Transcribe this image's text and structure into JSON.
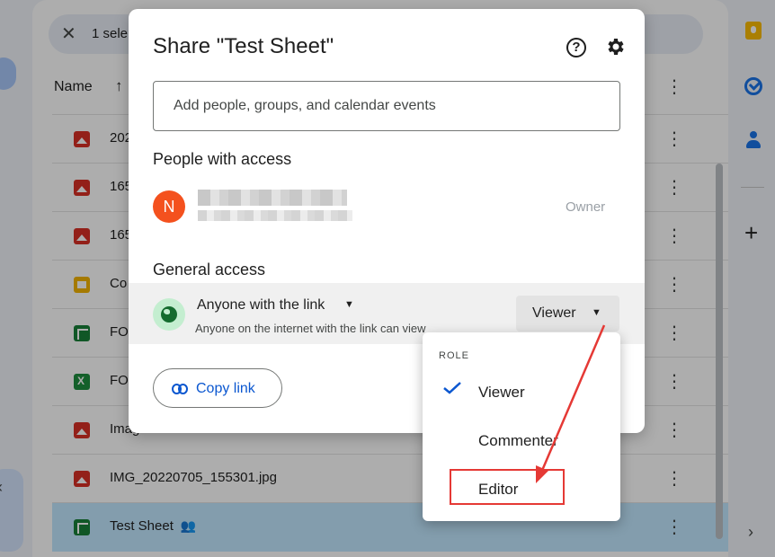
{
  "background": {
    "selection_count": "1 sele",
    "header": {
      "name": "Name"
    },
    "files": [
      {
        "name": "202",
        "type": "image",
        "selected": false
      },
      {
        "name": "165",
        "type": "image",
        "selected": false
      },
      {
        "name": "165",
        "type": "image",
        "selected": false
      },
      {
        "name": "Co",
        "type": "slides",
        "selected": false
      },
      {
        "name": "FO",
        "type": "sheet",
        "selected": false
      },
      {
        "name": "FO",
        "type": "excel",
        "selected": false
      },
      {
        "name": "Image-",
        "type": "image",
        "selected": false
      },
      {
        "name": "IMG_20220705_155301.jpg",
        "type": "image",
        "selected": false
      },
      {
        "name": "Test Sheet",
        "type": "sheet",
        "selected": true,
        "shared": true
      }
    ]
  },
  "dialog": {
    "title": "Share \"Test Sheet\"",
    "add_people_placeholder": "Add people, groups, and calendar events",
    "people_with_access_title": "People with access",
    "owner": {
      "initial": "N",
      "role": "Owner"
    },
    "general_access_title": "General access",
    "general_access": {
      "link_setting": "Anyone with the link",
      "description": "Anyone on the internet with the link can view",
      "role": "Viewer"
    },
    "copy_link_label": "Copy link"
  },
  "role_menu": {
    "heading": "ROLE",
    "items": [
      {
        "label": "Viewer",
        "checked": true
      },
      {
        "label": "Commenter",
        "checked": false
      },
      {
        "label": "Editor",
        "checked": false,
        "highlighted": true
      }
    ]
  },
  "colors": {
    "accent": "#0b57d0",
    "annotation": "#e53935",
    "selected_row": "#c2e7ff",
    "avatar": "#f4511e"
  }
}
